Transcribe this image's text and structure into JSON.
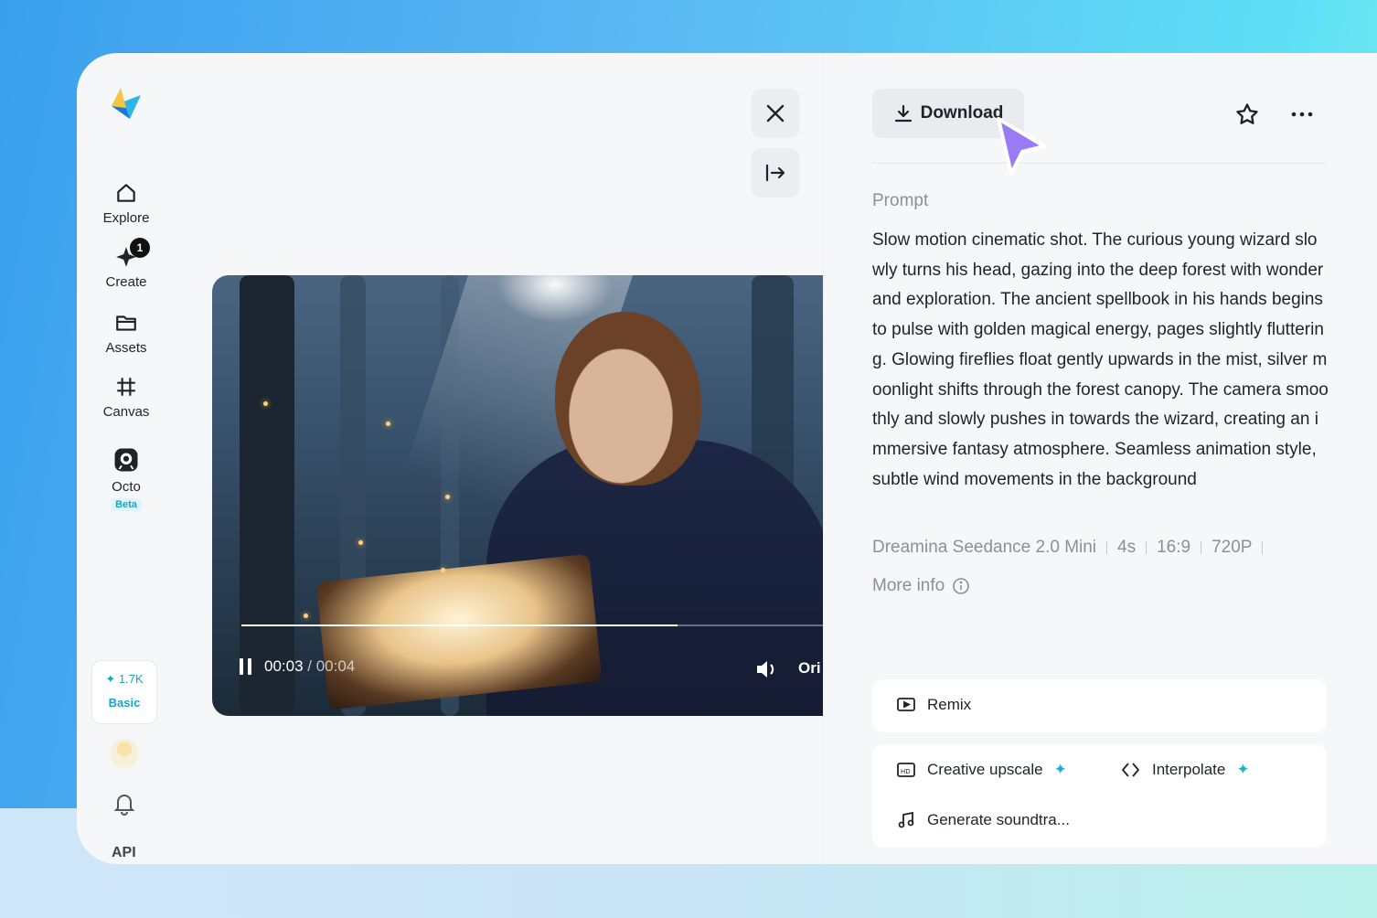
{
  "sidebar": {
    "items": [
      {
        "label": "Explore",
        "icon": "home-icon"
      },
      {
        "label": "Create",
        "icon": "create-sparkle-icon",
        "badge": "1"
      },
      {
        "label": "Assets",
        "icon": "folder-icon"
      },
      {
        "label": "Canvas",
        "icon": "canvas-grid-icon"
      },
      {
        "label": "Octo",
        "icon": "octo-icon",
        "tag": "Beta"
      }
    ],
    "credits": {
      "amount": "1.7K",
      "plan": "Basic"
    },
    "api_label": "API"
  },
  "player": {
    "current_time": "00:03",
    "separator": " / ",
    "duration": "00:04",
    "progress": 0.75,
    "quality_label": "Ori"
  },
  "panel": {
    "download_label": "Download",
    "prompt_label": "Prompt",
    "prompt_text": "Slow motion cinematic shot. The curious young wizard slowly turns his head, gazing into the deep forest with wonder and exploration. The ancient spellbook in his hands begins to pulse with golden magical energy, pages slightly fluttering. Glowing fireflies float gently upwards in the mist, silver moonlight shifts through the forest canopy. The camera smoothly and slowly pushes in towards the wizard, creating an immersive fantasy atmosphere. Seamless animation style, subtle wind movements in the background",
    "meta": [
      "Dreamina Seedance 2.0 Mini",
      "4s",
      "16:9",
      "720P"
    ],
    "more_info_label": "More info",
    "actions": {
      "remix": "Remix",
      "creative_upscale": "Creative upscale",
      "interpolate": "Interpolate",
      "generate_soundtrack": "Generate soundtra..."
    }
  },
  "colors": {
    "accent": "#1bb3d4",
    "cursor": "#9b7bf5"
  }
}
